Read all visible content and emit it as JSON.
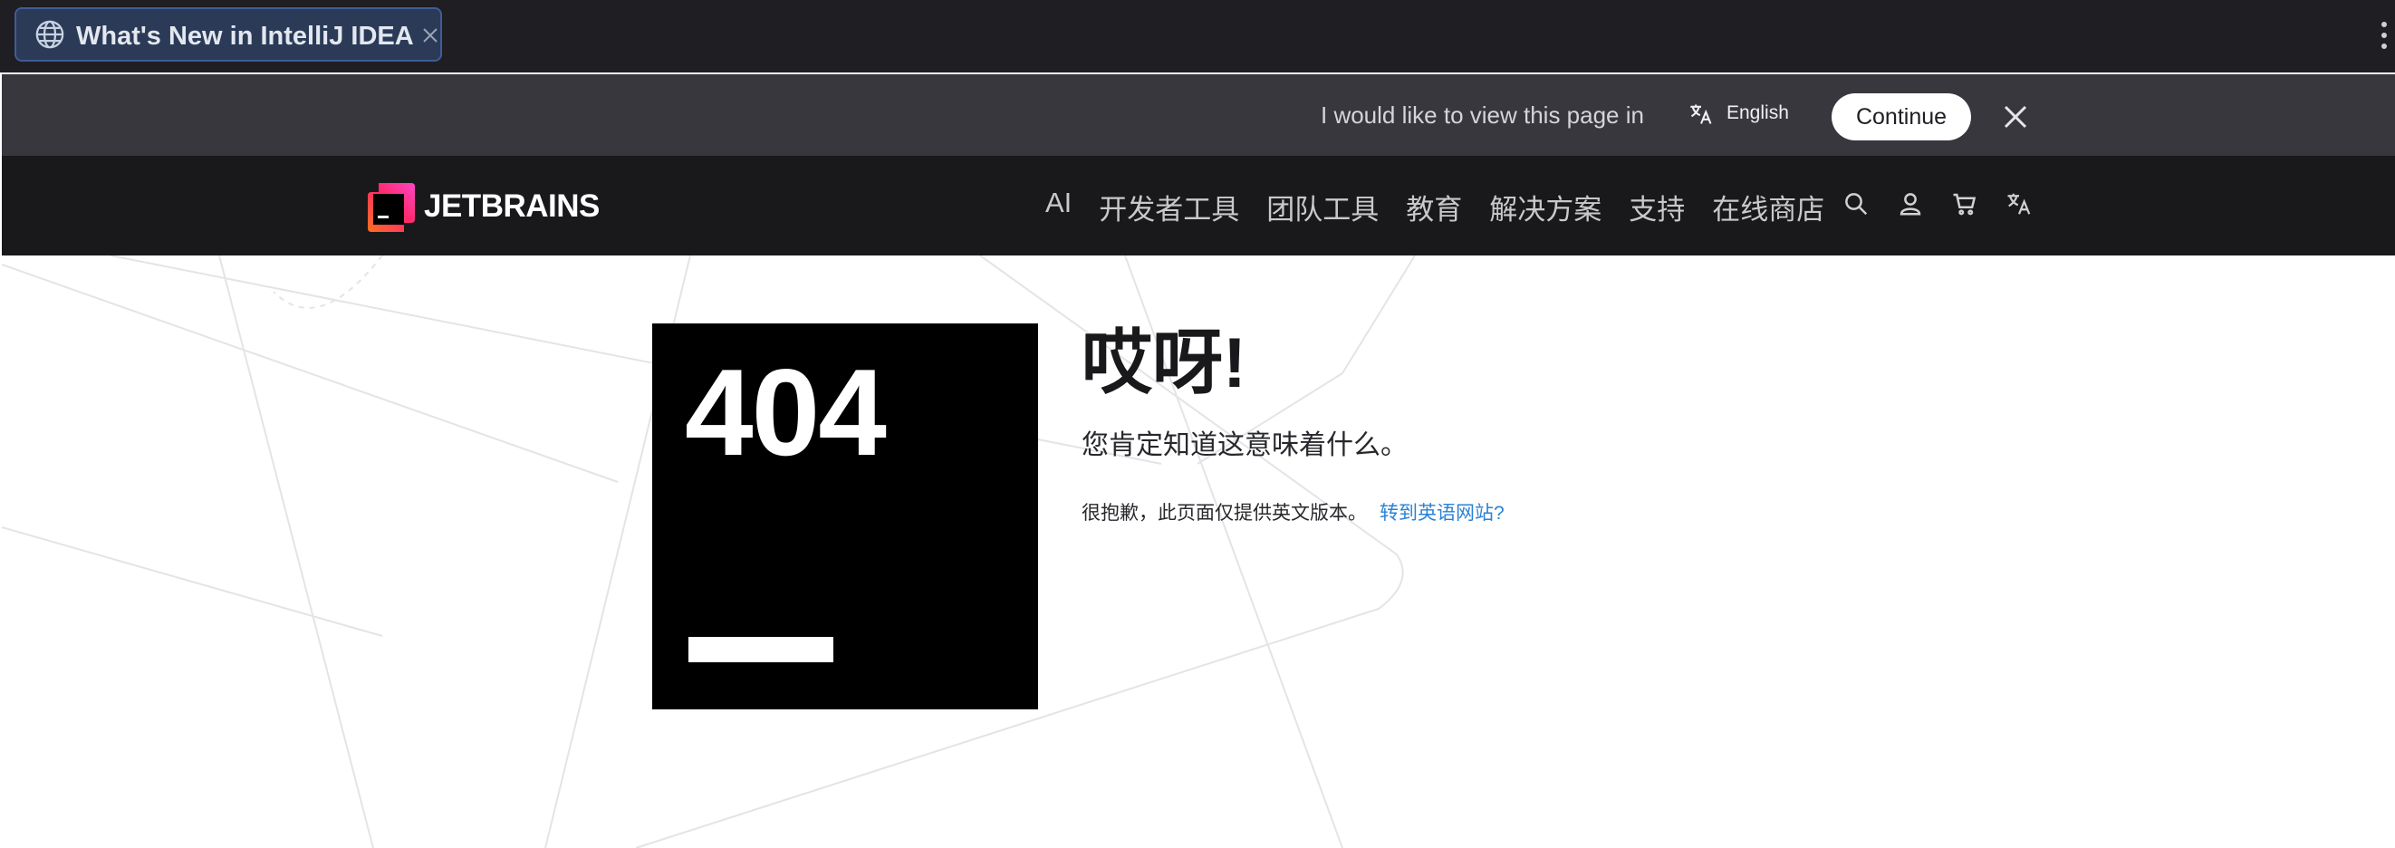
{
  "browser": {
    "tab_title": "What's New in IntelliJ IDEA",
    "tab_icon": "globe-icon",
    "accent": "#3f5c99"
  },
  "translate_bar": {
    "prompt": "I would like to view this page in",
    "language": "English",
    "continue_label": "Continue"
  },
  "header": {
    "logo_text": "JETBRAINS",
    "nav": [
      "AI",
      "开发者工具",
      "团队工具",
      "教育",
      "解决方案",
      "支持",
      "在线商店"
    ],
    "icons": [
      "search-icon",
      "user-icon",
      "cart-icon",
      "translate-icon"
    ]
  },
  "main": {
    "code": "404",
    "title": "哎呀!",
    "subtitle": "您肯定知道这意味着什么。",
    "note": "很抱歉，此页面仅提供英文版本。",
    "link": "转到英语网站?",
    "link_color": "#2a82d6"
  }
}
